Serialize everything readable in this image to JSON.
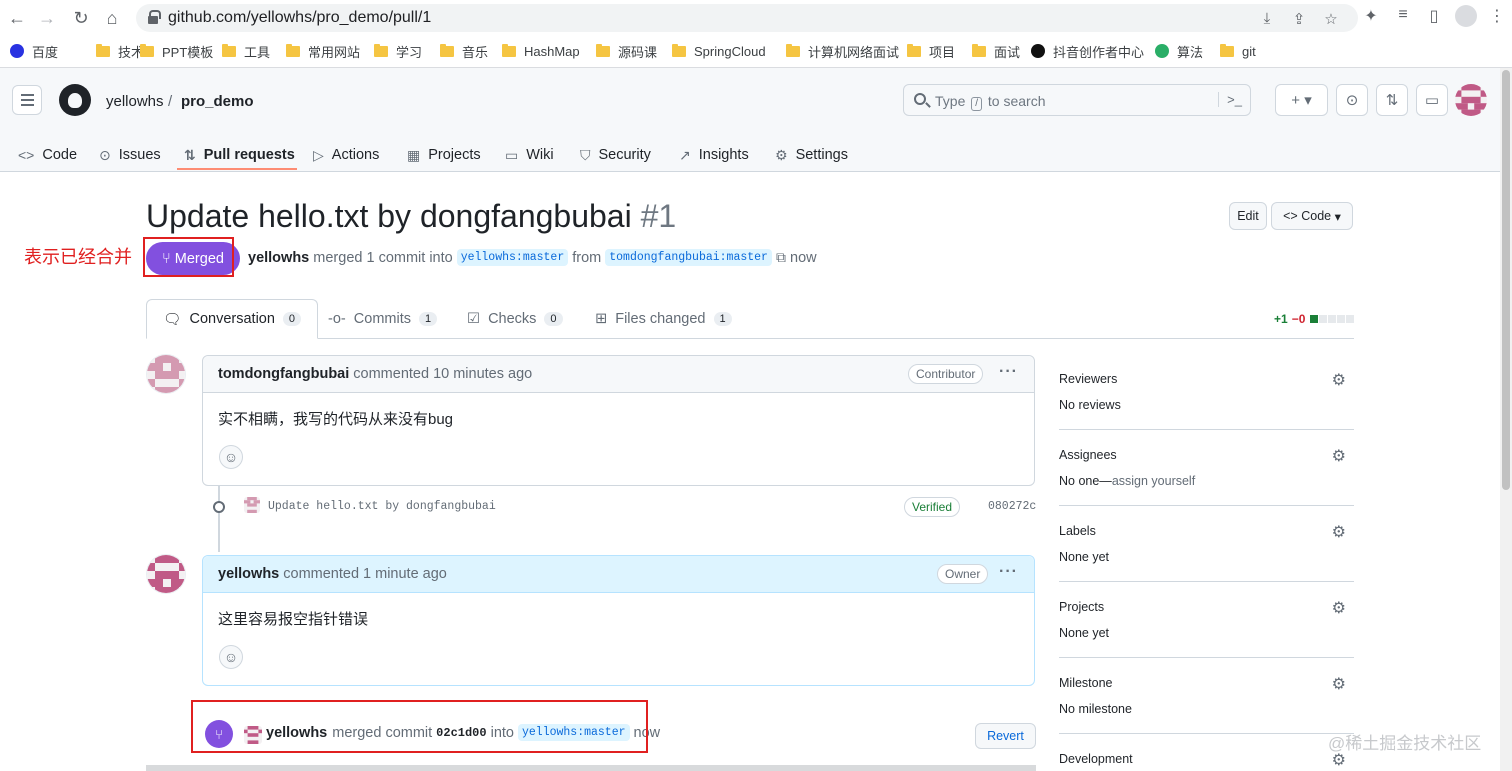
{
  "browser": {
    "url": "github.com/yellowhs/pro_demo/pull/1",
    "bookmarks": [
      {
        "label": "百度",
        "icon": "baidu-icon"
      },
      {
        "label": "技术",
        "icon": "folder-icon"
      },
      {
        "label": "PPT模板",
        "icon": "folder-icon"
      },
      {
        "label": "工具",
        "icon": "folder-icon"
      },
      {
        "label": "常用网站",
        "icon": "folder-icon"
      },
      {
        "label": "学习",
        "icon": "folder-icon"
      },
      {
        "label": "音乐",
        "icon": "folder-icon"
      },
      {
        "label": "HashMap",
        "icon": "folder-icon"
      },
      {
        "label": "源码课",
        "icon": "folder-icon"
      },
      {
        "label": "SpringCloud",
        "icon": "folder-icon"
      },
      {
        "label": "计算机网络面试",
        "icon": "folder-icon"
      },
      {
        "label": "项目",
        "icon": "folder-icon"
      },
      {
        "label": "面试",
        "icon": "folder-icon"
      },
      {
        "label": "抖音创作者中心",
        "icon": "douyin-icon"
      },
      {
        "label": "算法",
        "icon": "wechat-icon"
      },
      {
        "label": "git",
        "icon": "folder-icon"
      }
    ]
  },
  "header": {
    "owner": "yellowhs",
    "separator": "/",
    "repo": "pro_demo",
    "search_prefix": "Type",
    "search_key": "/",
    "search_suffix": "to search",
    "plus": "+",
    "command": ">_"
  },
  "repo_tabs": [
    {
      "label": "Code",
      "icon": "<>"
    },
    {
      "label": "Issues",
      "icon": "⊙"
    },
    {
      "label": "Pull requests",
      "icon": "⇅"
    },
    {
      "label": "Actions",
      "icon": "▷"
    },
    {
      "label": "Projects",
      "icon": "▦"
    },
    {
      "label": "Wiki",
      "icon": "▭"
    },
    {
      "label": "Security",
      "icon": "⛉"
    },
    {
      "label": "Insights",
      "icon": "↗"
    },
    {
      "label": "Settings",
      "icon": "⚙"
    }
  ],
  "pr": {
    "title": "Update hello.txt by dongfangbubai",
    "number": "#1",
    "edit": "Edit",
    "code": "Code",
    "status": "Merged",
    "annotation": "表示已经合并",
    "author": "yellowhs",
    "merged_text": "merged 1 commit into",
    "base_branch": "yellowhs:master",
    "from": "from",
    "head_branch": "tomdongfangbubai:master",
    "time": "now"
  },
  "conv_tabs": [
    {
      "label": "Conversation",
      "count": "0"
    },
    {
      "label": "Commits",
      "count": "1"
    },
    {
      "label": "Checks",
      "count": "0"
    },
    {
      "label": "Files changed",
      "count": "1"
    }
  ],
  "diffstat": {
    "add": "+1",
    "del": "−0"
  },
  "comments": [
    {
      "author": "tomdongfangbubai",
      "meta": "commented 10 minutes ago",
      "role": "Contributor",
      "body": "实不相瞒，我写的代码从来没有bug"
    },
    {
      "author": "yellowhs",
      "meta": "commented 1 minute ago",
      "role": "Owner",
      "body": "这里容易报空指针错误"
    }
  ],
  "commit": {
    "message": "Update hello.txt by dongfangbubai",
    "verified": "Verified",
    "sha": "080272c"
  },
  "merge_event": {
    "author": "yellowhs",
    "text": "merged commit",
    "sha": "02c1d00",
    "into": "into",
    "branch": "yellowhs:master",
    "time": "now",
    "revert": "Revert"
  },
  "sidebar": [
    {
      "heading": "Reviewers",
      "value": "No reviews",
      "value_link": ""
    },
    {
      "heading": "Assignees",
      "value": "No one—",
      "value_link": "assign yourself"
    },
    {
      "heading": "Labels",
      "value": "None yet",
      "value_link": ""
    },
    {
      "heading": "Projects",
      "value": "None yet",
      "value_link": ""
    },
    {
      "heading": "Milestone",
      "value": "No milestone",
      "value_link": ""
    },
    {
      "heading": "Development",
      "value": "",
      "value_link": ""
    }
  ],
  "watermark": "@稀土掘金技术社区",
  "colors": {
    "merged": "#8250df",
    "accent": "#fd8c73",
    "link": "#0969da",
    "annotation": "#e02020"
  }
}
